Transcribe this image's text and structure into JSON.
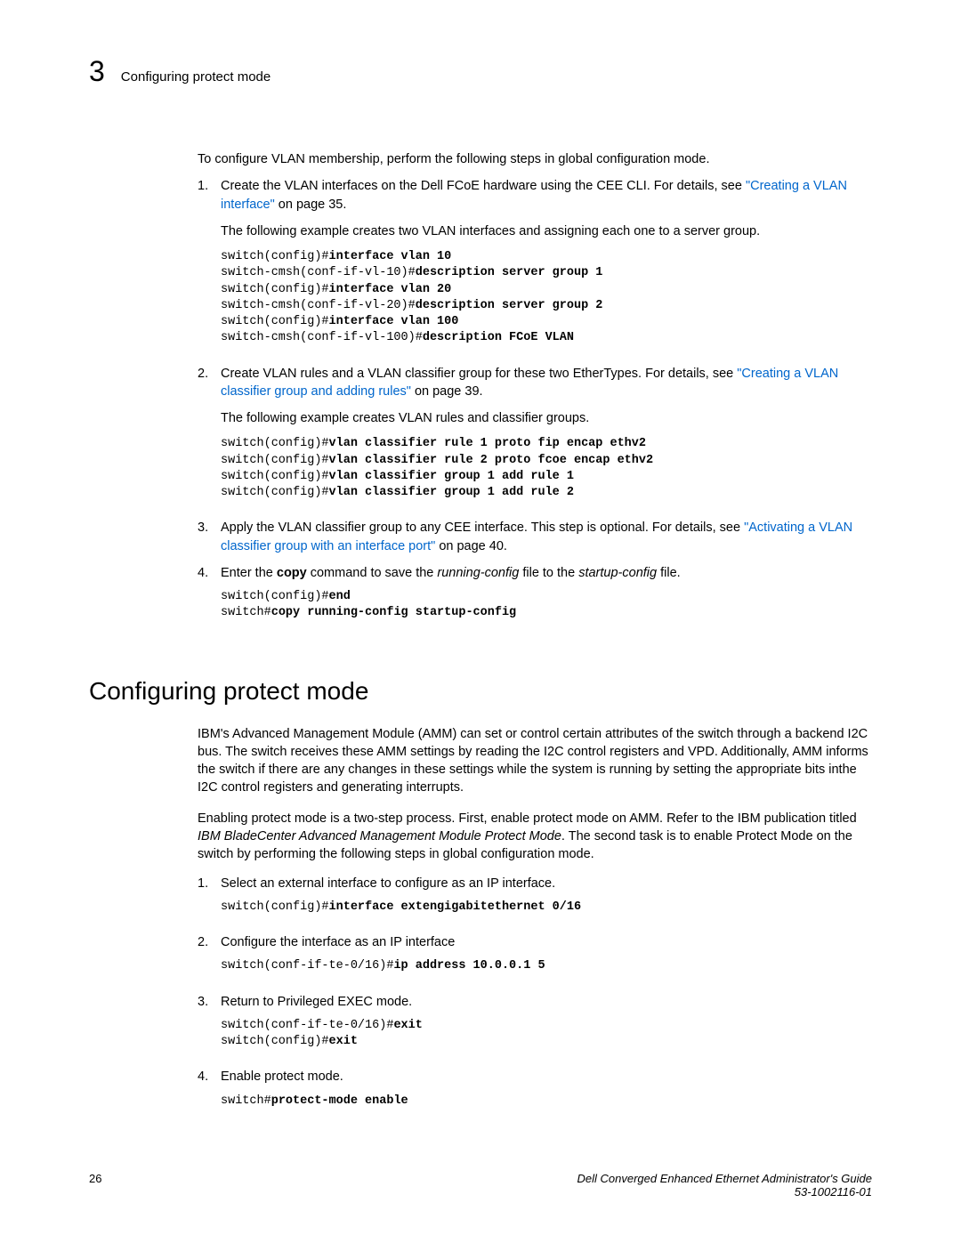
{
  "header": {
    "chapter_number": "3",
    "title": "Configuring protect mode"
  },
  "intro": "To configure VLAN membership, perform the following steps in global configuration mode.",
  "step1": {
    "num": "1.",
    "text_before": "Create the VLAN interfaces on the Dell FCoE hardware using the CEE CLI. For details, see ",
    "link": "\"Creating a VLAN interface\"",
    "text_after": " on page 35.",
    "sub": "The following example creates two VLAN interfaces and assigning each one to a server group.",
    "code": {
      "l1p": "switch(config)#",
      "l1c": "interface vlan 10",
      "l2p": "switch-cmsh(conf-if-vl-10)#",
      "l2c": "description server group 1",
      "l3p": "switch(config)#",
      "l3c": "interface vlan 20",
      "l4p": "switch-cmsh(conf-if-vl-20)#",
      "l4c": "description server group 2",
      "l5p": "switch(config)#",
      "l5c": "interface vlan 100",
      "l6p": "switch-cmsh(conf-if-vl-100)#",
      "l6c": "description FCoE VLAN"
    }
  },
  "step2": {
    "num": "2.",
    "text_before": "Create VLAN rules and a VLAN classifier group for these two EtherTypes. For details, see ",
    "link": "\"Creating a VLAN classifier group and adding rules\"",
    "text_after": " on page 39.",
    "sub": "The following example creates VLAN rules and classifier groups.",
    "code": {
      "l1p": "switch(config)#",
      "l1c": "vlan classifier rule 1 proto fip encap ethv2",
      "l2p": "switch(config)#",
      "l2c": "vlan classifier rule 2 proto fcoe encap ethv2",
      "l3p": "switch(config)#",
      "l3c": "vlan classifier group 1 add rule 1",
      "l4p": "switch(config)#",
      "l4c": "vlan classifier group 1 add rule 2"
    }
  },
  "step3": {
    "num": "3.",
    "text_before": "Apply the VLAN classifier group to any CEE interface. This step is optional. For details, see ",
    "link": "\"Activating a VLAN classifier group with an interface port\"",
    "text_after": " on page 40."
  },
  "step4": {
    "num": "4.",
    "text_a": "Enter the ",
    "cmd": "copy",
    "text_b": " command to save the ",
    "it1": "running-config",
    "text_c": " file to the ",
    "it2": "startup-config",
    "text_d": " file.",
    "code": {
      "l1p": "switch(config)#",
      "l1c": "end",
      "l2p": "switch#",
      "l2c": "copy running-config startup-config"
    }
  },
  "section2": {
    "heading": "Configuring protect mode",
    "p1": "IBM's Advanced Management Module (AMM) can set or control certain attributes of the switch through a backend I2C bus. The switch receives these AMM settings by reading the I2C control registers and VPD.  Additionally, AMM informs the switch if there are any changes in these settings while the system is running by setting the appropriate bits inthe I2C control registers and generating interrupts.",
    "p2a": "Enabling protect mode is a two-step process. First, enable protect mode on  AMM. Refer to the IBM publication titled ",
    "p2it": "IBM BladeCenter Advanced Management Module Protect Mode",
    "p2b": ". The second task is to enable Protect Mode on the switch by performing the following steps in global configuration mode.",
    "s1": {
      "num": "1.",
      "text": "Select an external interface to configure as an IP interface.",
      "code_p": "switch(config)#",
      "code_c": "interface extengigabitethernet 0/16"
    },
    "s2": {
      "num": "2.",
      "text": "Configure the interface as an IP interface",
      "code_p": "switch(conf-if-te-0/16)#",
      "code_c": "ip address 10.0.0.1 5"
    },
    "s3": {
      "num": "3.",
      "text": "Return to Privileged EXEC mode.",
      "code1_p": "switch(conf-if-te-0/16)#",
      "code1_c": "exit",
      "code2_p": "switch(config)#",
      "code2_c": "exit"
    },
    "s4": {
      "num": "4.",
      "text": "Enable protect mode.",
      "code_p": "switch#",
      "code_c": "protect-mode enable"
    }
  },
  "footer": {
    "page": "26",
    "doc_title": "Dell Converged Enhanced Ethernet Administrator's Guide",
    "doc_id": "53-1002116-01"
  }
}
